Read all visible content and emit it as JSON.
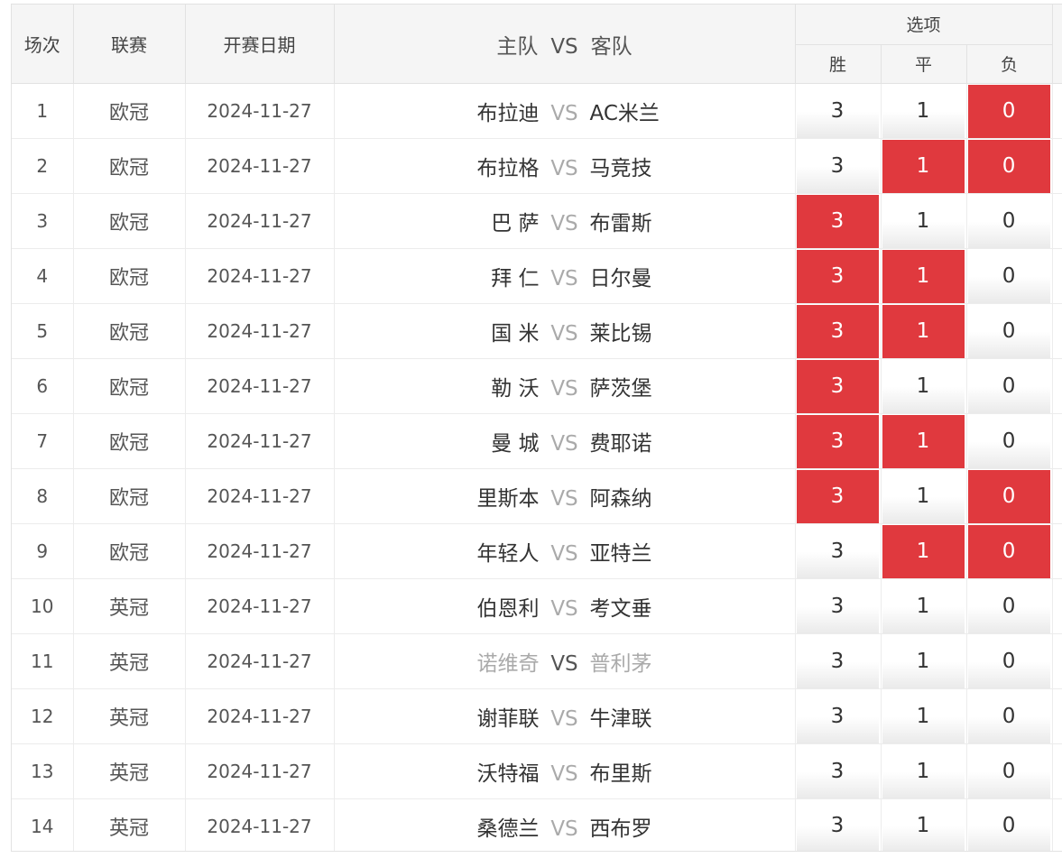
{
  "header": {
    "no": "场次",
    "league": "联赛",
    "date": "开赛日期",
    "home": "主队",
    "vs": "VS",
    "away": "客队",
    "options": "选项",
    "win": "胜",
    "draw": "平",
    "lose": "负"
  },
  "accent_color": "#e0393e",
  "rows": [
    {
      "no": "1",
      "league": "欧冠",
      "date": "2024-11-27",
      "home": "布拉迪",
      "vs": "VS",
      "away": "AC米兰",
      "win": "3",
      "draw": "1",
      "lose": "0",
      "sel": [
        false,
        false,
        true
      ]
    },
    {
      "no": "2",
      "league": "欧冠",
      "date": "2024-11-27",
      "home": "布拉格",
      "vs": "VS",
      "away": "马竞技",
      "win": "3",
      "draw": "1",
      "lose": "0",
      "sel": [
        false,
        true,
        true
      ]
    },
    {
      "no": "3",
      "league": "欧冠",
      "date": "2024-11-27",
      "home": "巴 萨",
      "vs": "VS",
      "away": "布雷斯",
      "win": "3",
      "draw": "1",
      "lose": "0",
      "sel": [
        true,
        false,
        false
      ]
    },
    {
      "no": "4",
      "league": "欧冠",
      "date": "2024-11-27",
      "home": "拜 仁",
      "vs": "VS",
      "away": "日尔曼",
      "win": "3",
      "draw": "1",
      "lose": "0",
      "sel": [
        true,
        true,
        false
      ]
    },
    {
      "no": "5",
      "league": "欧冠",
      "date": "2024-11-27",
      "home": "国 米",
      "vs": "VS",
      "away": "莱比锡",
      "win": "3",
      "draw": "1",
      "lose": "0",
      "sel": [
        true,
        true,
        false
      ]
    },
    {
      "no": "6",
      "league": "欧冠",
      "date": "2024-11-27",
      "home": "勒 沃",
      "vs": "VS",
      "away": "萨茨堡",
      "win": "3",
      "draw": "1",
      "lose": "0",
      "sel": [
        true,
        false,
        false
      ]
    },
    {
      "no": "7",
      "league": "欧冠",
      "date": "2024-11-27",
      "home": "曼 城",
      "vs": "VS",
      "away": "费耶诺",
      "win": "3",
      "draw": "1",
      "lose": "0",
      "sel": [
        true,
        true,
        false
      ]
    },
    {
      "no": "8",
      "league": "欧冠",
      "date": "2024-11-27",
      "home": "里斯本",
      "vs": "VS",
      "away": "阿森纳",
      "win": "3",
      "draw": "1",
      "lose": "0",
      "sel": [
        true,
        false,
        true
      ]
    },
    {
      "no": "9",
      "league": "欧冠",
      "date": "2024-11-27",
      "home": "年轻人",
      "vs": "VS",
      "away": "亚特兰",
      "win": "3",
      "draw": "1",
      "lose": "0",
      "sel": [
        false,
        true,
        true
      ]
    },
    {
      "no": "10",
      "league": "英冠",
      "date": "2024-11-27",
      "home": "伯恩利",
      "vs": "VS",
      "away": "考文垂",
      "win": "3",
      "draw": "1",
      "lose": "0",
      "sel": [
        false,
        false,
        false
      ]
    },
    {
      "no": "11",
      "league": "英冠",
      "date": "2024-11-27",
      "home": "诺维奇",
      "vs": "VS",
      "away": "普利茅",
      "win": "3",
      "draw": "1",
      "lose": "0",
      "sel": [
        false,
        false,
        false
      ],
      "muted": true
    },
    {
      "no": "12",
      "league": "英冠",
      "date": "2024-11-27",
      "home": "谢菲联",
      "vs": "VS",
      "away": "牛津联",
      "win": "3",
      "draw": "1",
      "lose": "0",
      "sel": [
        false,
        false,
        false
      ]
    },
    {
      "no": "13",
      "league": "英冠",
      "date": "2024-11-27",
      "home": "沃特福",
      "vs": "VS",
      "away": "布里斯",
      "win": "3",
      "draw": "1",
      "lose": "0",
      "sel": [
        false,
        false,
        false
      ]
    },
    {
      "no": "14",
      "league": "英冠",
      "date": "2024-11-27",
      "home": "桑德兰",
      "vs": "VS",
      "away": "西布罗",
      "win": "3",
      "draw": "1",
      "lose": "0",
      "sel": [
        false,
        false,
        false
      ]
    }
  ]
}
